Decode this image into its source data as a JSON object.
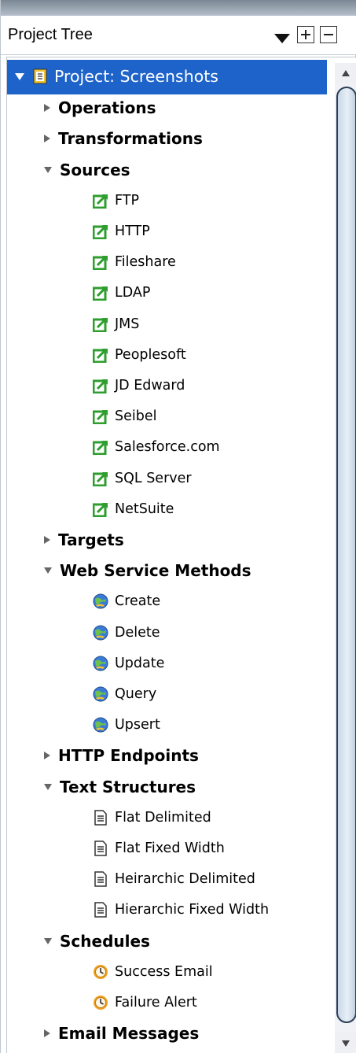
{
  "panel": {
    "title": "Project Tree",
    "controls": {
      "dropdown_icon": "dropdown-arrow-icon",
      "expand_icon": "expand-all-icon",
      "collapse_icon": "collapse-all-icon"
    }
  },
  "tree": {
    "root": {
      "label": "Project: Screenshots",
      "icon": "project-icon",
      "expanded": true,
      "selected": true
    },
    "groups": [
      {
        "label": "Operations",
        "expanded": false,
        "items": []
      },
      {
        "label": "Transformations",
        "expanded": false,
        "items": []
      },
      {
        "label": "Sources",
        "expanded": true,
        "item_icon": "source-edit-icon",
        "items": [
          "FTP",
          "HTTP",
          "Fileshare",
          "LDAP",
          "JMS",
          "Peoplesoft",
          "JD Edward",
          "Seibel",
          "Salesforce.com",
          "SQL Server",
          "NetSuite"
        ]
      },
      {
        "label": "Targets",
        "expanded": false,
        "items": []
      },
      {
        "label": "Web Service Methods",
        "expanded": true,
        "item_icon": "globe-icon",
        "items": [
          "Create",
          "Delete",
          "Update",
          "Query",
          "Upsert"
        ]
      },
      {
        "label": "HTTP Endpoints",
        "expanded": false,
        "items": []
      },
      {
        "label": "Text Structures",
        "expanded": true,
        "item_icon": "document-icon",
        "items": [
          "Flat Delimited",
          "Flat Fixed Width",
          "Heirarchic Delimited",
          "Hierarchic Fixed Width"
        ]
      },
      {
        "label": "Schedules",
        "expanded": true,
        "item_icon": "clock-icon",
        "items": [
          "Success Email",
          "Failure Alert"
        ]
      },
      {
        "label": "Email Messages",
        "expanded": false,
        "items": []
      }
    ]
  },
  "colors": {
    "selection": "#1e63c9",
    "source_icon": "#2e9e2e",
    "clock_icon": "#f0a020",
    "globe_icon": "#3b7bd6"
  }
}
